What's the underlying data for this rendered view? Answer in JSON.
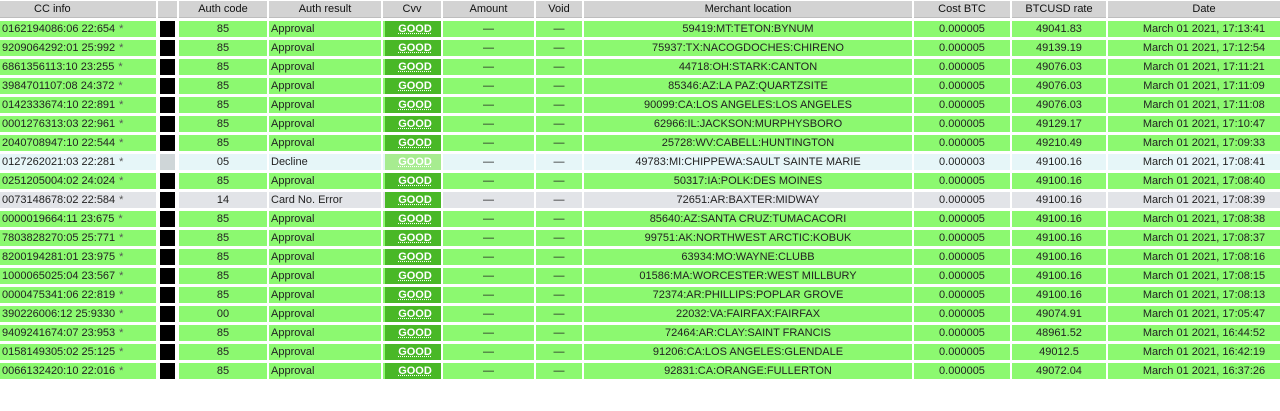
{
  "headers": [
    "CC info",
    "",
    "Auth code",
    "Auth result",
    "Cvv",
    "Amount",
    "Void",
    "Merchant location",
    "Cost BTC",
    "BTCUSD rate",
    "Date"
  ],
  "rows": [
    {
      "status": "ok",
      "cc": "0162194086:06 22:654",
      "star": "*",
      "auth_code": "85",
      "auth_result": "Approval",
      "cvv": "GOOD",
      "amount": "—",
      "void": "—",
      "location": "59419:MT:TETON:BYNUM",
      "cost": "0.000005",
      "rate": "49041.83",
      "date": "March 01 2021, 17:13:41"
    },
    {
      "status": "ok",
      "cc": "9209064292:01 25:992",
      "star": "*",
      "auth_code": "85",
      "auth_result": "Approval",
      "cvv": "GOOD",
      "amount": "—",
      "void": "—",
      "location": "75937:TX:NACOGDOCHES:CHIRENO",
      "cost": "0.000005",
      "rate": "49139.19",
      "date": "March 01 2021, 17:12:54"
    },
    {
      "status": "ok",
      "cc": "6861356113:10 23:255",
      "star": "*",
      "auth_code": "85",
      "auth_result": "Approval",
      "cvv": "GOOD",
      "amount": "—",
      "void": "—",
      "location": "44718:OH:STARK:CANTON",
      "cost": "0.000005",
      "rate": "49076.03",
      "date": "March 01 2021, 17:11:21"
    },
    {
      "status": "ok",
      "cc": "3984701107:08 24:372",
      "star": "*",
      "auth_code": "85",
      "auth_result": "Approval",
      "cvv": "GOOD",
      "amount": "—",
      "void": "—",
      "location": "85346:AZ:LA PAZ:QUARTZSITE",
      "cost": "0.000005",
      "rate": "49076.03",
      "date": "March 01 2021, 17:11:09"
    },
    {
      "status": "ok",
      "cc": "0142333674:10 22:891",
      "star": "*",
      "auth_code": "85",
      "auth_result": "Approval",
      "cvv": "GOOD",
      "amount": "—",
      "void": "—",
      "location": "90099:CA:LOS ANGELES:LOS ANGELES",
      "cost": "0.000005",
      "rate": "49076.03",
      "date": "March 01 2021, 17:11:08"
    },
    {
      "status": "ok",
      "cc": "0001276313:03 22:961",
      "star": "*",
      "auth_code": "85",
      "auth_result": "Approval",
      "cvv": "GOOD",
      "amount": "—",
      "void": "—",
      "location": "62966:IL:JACKSON:MURPHYSBORO",
      "cost": "0.000005",
      "rate": "49129.17",
      "date": "March 01 2021, 17:10:47"
    },
    {
      "status": "ok",
      "cc": "2040708947:10 22:544",
      "star": "*",
      "auth_code": "85",
      "auth_result": "Approval",
      "cvv": "GOOD",
      "amount": "—",
      "void": "—",
      "location": "25728:WV:CABELL:HUNTINGTON",
      "cost": "0.000005",
      "rate": "49210.49",
      "date": "March 01 2021, 17:09:33"
    },
    {
      "status": "decline",
      "cc": "0127262021:03 22:281",
      "star": "*",
      "auth_code": "05",
      "auth_result": "Decline",
      "cvv": "GOOD",
      "amount": "—",
      "void": "—",
      "location": "49783:MI:CHIPPEWA:SAULT SAINTE MARIE",
      "cost": "0.000003",
      "rate": "49100.16",
      "date": "March 01 2021, 17:08:41"
    },
    {
      "status": "ok",
      "cc": "0251205004:02 24:024",
      "star": "*",
      "auth_code": "85",
      "auth_result": "Approval",
      "cvv": "GOOD",
      "amount": "—",
      "void": "—",
      "location": "50317:IA:POLK:DES MOINES",
      "cost": "0.000005",
      "rate": "49100.16",
      "date": "March 01 2021, 17:08:40"
    },
    {
      "status": "error",
      "cc": "0073148678:02 22:584",
      "star": "*",
      "auth_code": "14",
      "auth_result": "Card No. Error",
      "cvv": "GOOD",
      "amount": "—",
      "void": "—",
      "location": "72651:AR:BAXTER:MIDWAY",
      "cost": "0.000005",
      "rate": "49100.16",
      "date": "March 01 2021, 17:08:39"
    },
    {
      "status": "ok",
      "cc": "0000019664:11 23:675",
      "star": "*",
      "auth_code": "85",
      "auth_result": "Approval",
      "cvv": "GOOD",
      "amount": "—",
      "void": "—",
      "location": "85640:AZ:SANTA CRUZ:TUMACACORI",
      "cost": "0.000005",
      "rate": "49100.16",
      "date": "March 01 2021, 17:08:38"
    },
    {
      "status": "ok",
      "cc": "7803828270:05 25:771",
      "star": "*",
      "auth_code": "85",
      "auth_result": "Approval",
      "cvv": "GOOD",
      "amount": "—",
      "void": "—",
      "location": "99751:AK:NORTHWEST ARCTIC:KOBUK",
      "cost": "0.000005",
      "rate": "49100.16",
      "date": "March 01 2021, 17:08:37"
    },
    {
      "status": "ok",
      "cc": "8200194281:01 23:975",
      "star": "*",
      "auth_code": "85",
      "auth_result": "Approval",
      "cvv": "GOOD",
      "amount": "—",
      "void": "—",
      "location": "63934:MO:WAYNE:CLUBB",
      "cost": "0.000005",
      "rate": "49100.16",
      "date": "March 01 2021, 17:08:16"
    },
    {
      "status": "ok",
      "cc": "1000065025:04 23:567",
      "star": "*",
      "auth_code": "85",
      "auth_result": "Approval",
      "cvv": "GOOD",
      "amount": "—",
      "void": "—",
      "location": "01586:MA:WORCESTER:WEST MILLBURY",
      "cost": "0.000005",
      "rate": "49100.16",
      "date": "March 01 2021, 17:08:15"
    },
    {
      "status": "ok",
      "cc": "0000475341:06 22:819",
      "star": "*",
      "auth_code": "85",
      "auth_result": "Approval",
      "cvv": "GOOD",
      "amount": "—",
      "void": "—",
      "location": "72374:AR:PHILLIPS:POPLAR GROVE",
      "cost": "0.000005",
      "rate": "49100.16",
      "date": "March 01 2021, 17:08:13"
    },
    {
      "status": "ok",
      "cc": "390226006:12 25:9330",
      "star": "*",
      "auth_code": "00",
      "auth_result": "Approval",
      "cvv": "GOOD",
      "amount": "—",
      "void": "—",
      "location": "22032:VA:FAIRFAX:FAIRFAX",
      "cost": "0.000005",
      "rate": "49074.91",
      "date": "March 01 2021, 17:05:47"
    },
    {
      "status": "ok",
      "cc": "9409241674:07 23:953",
      "star": "*",
      "auth_code": "85",
      "auth_result": "Approval",
      "cvv": "GOOD",
      "amount": "—",
      "void": "—",
      "location": "72464:AR:CLAY:SAINT FRANCIS",
      "cost": "0.000005",
      "rate": "48961.52",
      "date": "March 01 2021, 16:44:52"
    },
    {
      "status": "ok",
      "cc": "0158149305:02 25:125",
      "star": "*",
      "auth_code": "85",
      "auth_result": "Approval",
      "cvv": "GOOD",
      "amount": "—",
      "void": "—",
      "location": "91206:CA:LOS ANGELES:GLENDALE",
      "cost": "0.000005",
      "rate": "49012.5",
      "date": "March 01 2021, 16:42:19"
    },
    {
      "status": "ok",
      "cc": "0066132420:10 22:016",
      "star": "*",
      "auth_code": "85",
      "auth_result": "Approval",
      "cvv": "GOOD",
      "amount": "—",
      "void": "—",
      "location": "92831:CA:ORANGE:FULLERTON",
      "cost": "0.000005",
      "rate": "49072.04",
      "date": "March 01 2021, 16:37:26"
    }
  ]
}
